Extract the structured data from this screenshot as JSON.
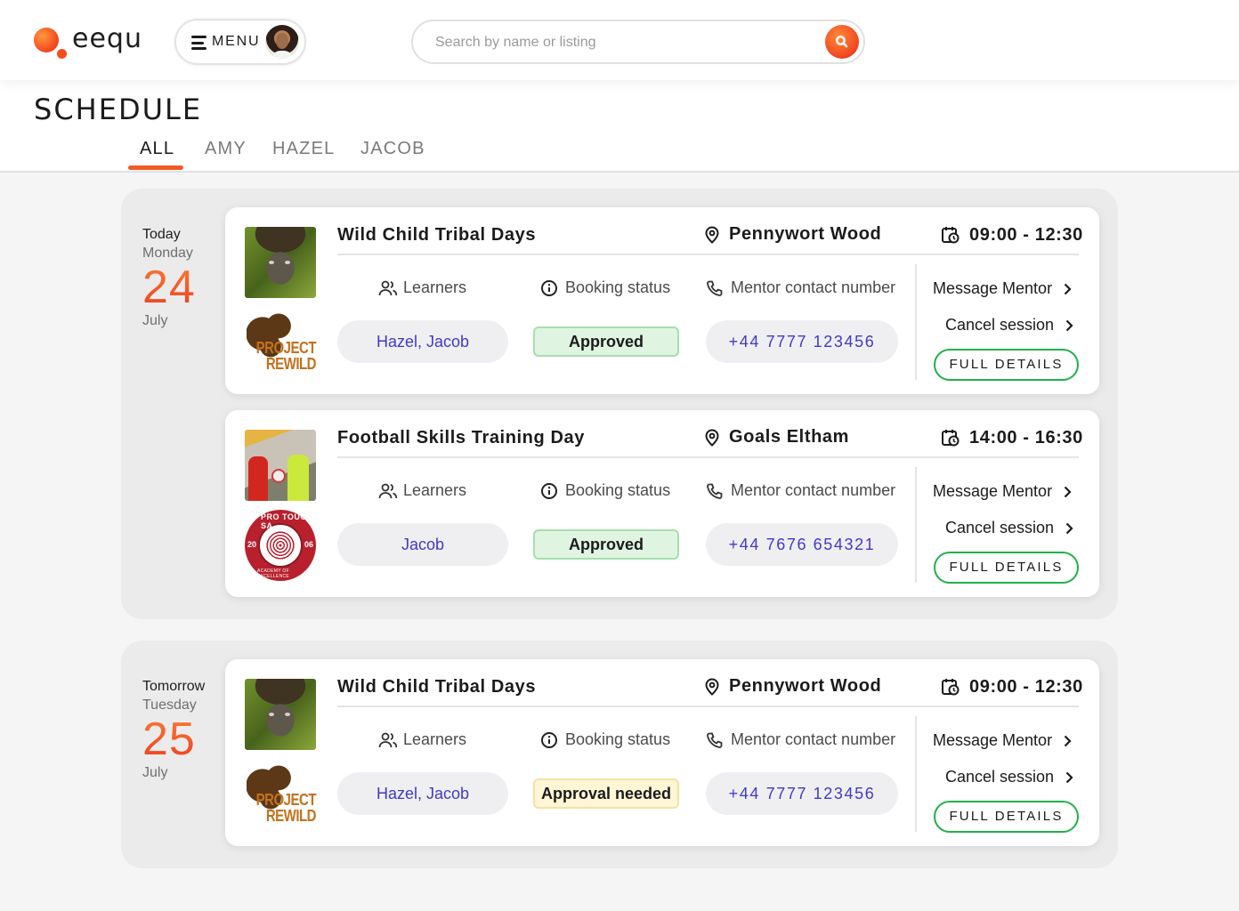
{
  "header": {
    "logo_text": "eequ",
    "menu_label": "MENU",
    "search_placeholder": "Search by name or listing"
  },
  "page": {
    "title": "SCHEDULE",
    "tabs": [
      {
        "label": "ALL",
        "active": true
      },
      {
        "label": "AMY",
        "active": false
      },
      {
        "label": "HAZEL",
        "active": false
      },
      {
        "label": "JACOB",
        "active": false
      }
    ]
  },
  "labels": {
    "learners": "Learners",
    "booking_status": "Booking status",
    "mentor_contact": "Mentor contact number",
    "message_mentor": "Message Mentor",
    "cancel_session": "Cancel session",
    "full_details": "FULL DETAILS"
  },
  "colors": {
    "accent": "#f35a24",
    "link": "#4338ca",
    "approved_bg": "#dff5e1",
    "approval_needed_bg": "#fff6d6",
    "details_border": "#22b04b"
  },
  "days": [
    {
      "relative": "Today",
      "weekday": "Monday",
      "day_num": "24",
      "month": "July",
      "sessions": [
        {
          "title": "Wild Child Tribal Days",
          "location": "Pennywort Wood",
          "time": "09:00 - 12:30",
          "learners": "Hazel, Jacob",
          "status": "Approved",
          "status_type": "approved",
          "phone": "+44 7777 123456",
          "org_logo": "project-rewild-logo",
          "org_text_1": "PROJECT",
          "org_text_2": "REWILD"
        },
        {
          "title": "Football Skills Training Day",
          "location": "Goals Eltham",
          "time": "14:00 - 16:30",
          "learners": "Jacob",
          "status": "Approved",
          "status_type": "approved",
          "phone": "+44 7676 654321",
          "org_logo": "pro-touch-sa-logo",
          "org_text_1": "PRO TOUCH SA",
          "org_text_2": "ACADEMY OF EXCELLENCE",
          "org_year_left": "20",
          "org_year_right": "06"
        }
      ]
    },
    {
      "relative": "Tomorrow",
      "weekday": "Tuesday",
      "day_num": "25",
      "month": "July",
      "sessions": [
        {
          "title": "Wild Child Tribal Days",
          "location": "Pennywort Wood",
          "time": "09:00 - 12:30",
          "learners": "Hazel, Jacob",
          "status": "Approval needed",
          "status_type": "pending",
          "phone": "+44 7777 123456",
          "org_logo": "project-rewild-logo",
          "org_text_1": "PROJECT",
          "org_text_2": "REWILD"
        }
      ]
    }
  ]
}
